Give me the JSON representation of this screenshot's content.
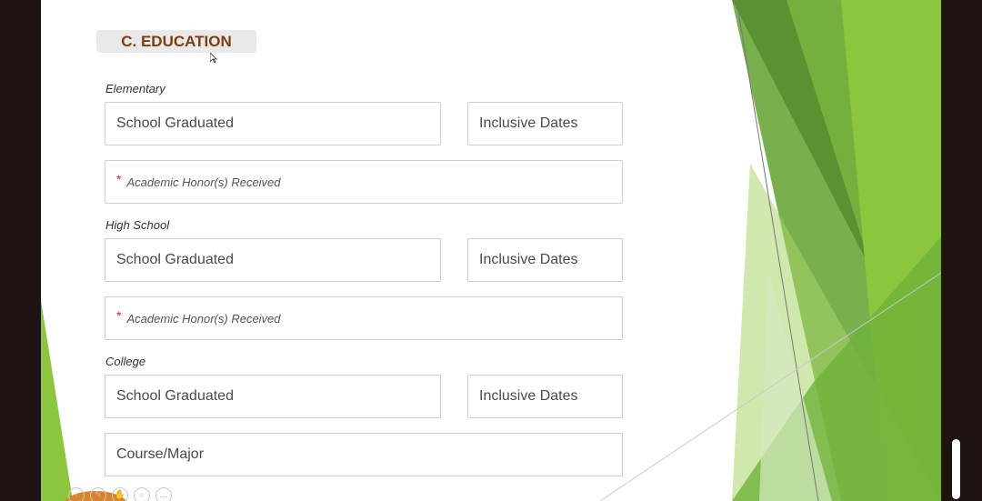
{
  "section": {
    "title": "C. EDUCATION"
  },
  "groups": [
    {
      "label": "Elementary",
      "school_placeholder": "School Graduated",
      "dates_placeholder": "Inclusive Dates",
      "extra_required_mark": "*",
      "extra_placeholder": "Academic Honor(s) Received"
    },
    {
      "label": "High School",
      "school_placeholder": "School Graduated",
      "dates_placeholder": "Inclusive Dates",
      "extra_required_mark": "*",
      "extra_placeholder": "Academic Honor(s) Received"
    },
    {
      "label": "College",
      "school_placeholder": "School Graduated",
      "dates_placeholder": "Inclusive Dates",
      "extra_placeholder": "Course/Major"
    }
  ],
  "toolbar_icons": [
    "previous-icon",
    "pen-icon",
    "hand-icon",
    "zoom-icon",
    "more-icon"
  ],
  "colors": {
    "title_text": "#7a3d14",
    "badge_bg": "#e9e9e9",
    "frame": "#1d1412",
    "green_dark": "#5a8f2e",
    "green_light": "#8cc63f",
    "required": "#d22222"
  }
}
